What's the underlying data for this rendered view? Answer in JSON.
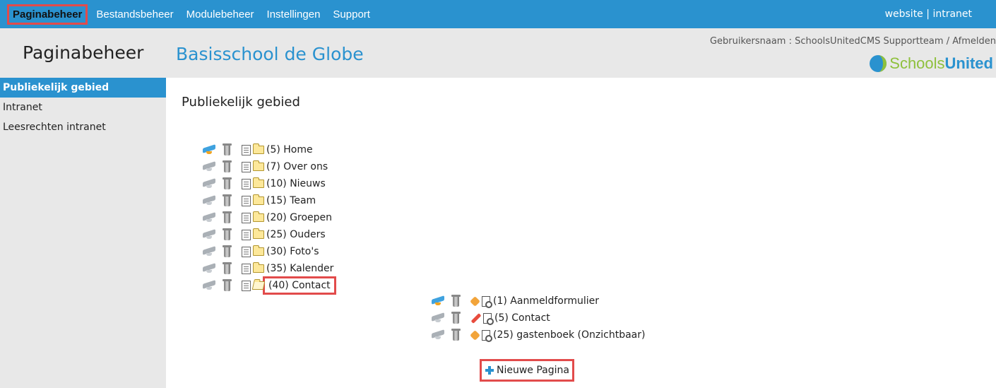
{
  "topnav": {
    "items": [
      {
        "label": "Paginabeheer",
        "active": true
      },
      {
        "label": "Bestandsbeheer",
        "active": false
      },
      {
        "label": "Modulebeheer",
        "active": false
      },
      {
        "label": "Instellingen",
        "active": false
      },
      {
        "label": "Support",
        "active": false
      }
    ],
    "right": {
      "website": "website",
      "separator": "|",
      "intranet": "intranet"
    }
  },
  "header": {
    "section_title": "Paginabeheer",
    "site_title": "Basisschool de Globe",
    "user_prefix": "Gebruikersnaam : ",
    "user_name": "SchoolsUnitedCMS Supportteam",
    "user_separator": " / ",
    "logout": "Afmelden",
    "logo_part1": "Schools",
    "logo_part2": "United"
  },
  "sidebar": {
    "items": [
      {
        "label": "Publiekelijk gebied",
        "active": true
      },
      {
        "label": "Intranet",
        "active": false
      },
      {
        "label": "Leesrechten intranet",
        "active": false
      }
    ]
  },
  "main": {
    "title": "Publiekelijk gebied",
    "tree": [
      {
        "label": "(5) Home",
        "hat_active": true,
        "folder_open": false
      },
      {
        "label": "(7) Over ons",
        "hat_active": false,
        "folder_open": false
      },
      {
        "label": "(10) Nieuws",
        "hat_active": false,
        "folder_open": false
      },
      {
        "label": "(15) Team",
        "hat_active": false,
        "folder_open": false
      },
      {
        "label": "(20) Groepen",
        "hat_active": false,
        "folder_open": false
      },
      {
        "label": "(25) Ouders",
        "hat_active": false,
        "folder_open": false
      },
      {
        "label": "(30) Foto's",
        "hat_active": false,
        "folder_open": false
      },
      {
        "label": "(35) Kalender",
        "hat_active": false,
        "folder_open": false
      },
      {
        "label": "(40) Contact",
        "hat_active": false,
        "folder_open": true
      }
    ],
    "subtree": [
      {
        "label": "(1) Aanmeldformulier",
        "hat_active": true,
        "status_icon": "package-icon"
      },
      {
        "label": "(5) Contact",
        "hat_active": false,
        "status_icon": "pencil-icon"
      },
      {
        "label": "(25) gastenboek (Onzichtbaar)",
        "hat_active": false,
        "status_icon": "package-icon"
      }
    ],
    "new_page_label": "Nieuwe Pagina"
  }
}
